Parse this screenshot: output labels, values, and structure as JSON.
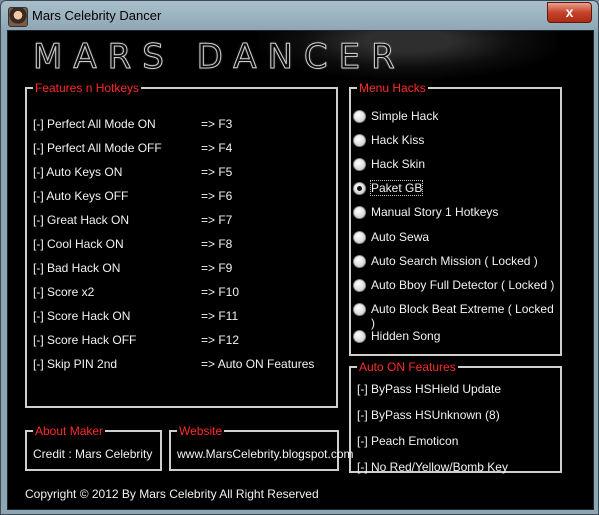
{
  "window": {
    "title": "Mars Celebrity Dancer",
    "close_glyph": "x"
  },
  "logo": "MARS DANCER",
  "features": {
    "legend": "Features n Hotkeys",
    "rows": [
      {
        "label": "[-] Perfect All Mode ON",
        "key": "=> F3"
      },
      {
        "label": "[-] Perfect All Mode OFF",
        "key": "=> F4"
      },
      {
        "label": "[-] Auto Keys ON",
        "key": "=> F5"
      },
      {
        "label": "[-] Auto Keys OFF",
        "key": "=> F6"
      },
      {
        "label": "[-] Great Hack ON",
        "key": "=> F7"
      },
      {
        "label": "[-] Cool Hack ON",
        "key": "=> F8"
      },
      {
        "label": "[-] Bad Hack ON",
        "key": "=> F9"
      },
      {
        "label": "[-] Score x2",
        "key": "=> F10"
      },
      {
        "label": "[-] Score Hack ON",
        "key": "=> F11"
      },
      {
        "label": "[-] Score Hack OFF",
        "key": "=> F12"
      },
      {
        "label": "[-] Skip PIN 2nd",
        "key": "=> Auto ON Features"
      }
    ]
  },
  "menu_hacks": {
    "legend": "Menu Hacks",
    "options": [
      {
        "label": "Simple Hack",
        "checked": false
      },
      {
        "label": "Hack Kiss",
        "checked": false
      },
      {
        "label": "Hack Skin",
        "checked": false
      },
      {
        "label": "Paket GB",
        "checked": true
      },
      {
        "label": "Manual Story 1 Hotkeys",
        "checked": false
      },
      {
        "label": "Auto Sewa",
        "checked": false
      },
      {
        "label": "Auto Search Mission ( Locked )",
        "checked": false
      },
      {
        "label": "Auto Bboy Full Detector ( Locked )",
        "checked": false
      },
      {
        "label": "Auto Block Beat Extreme ( Locked )",
        "checked": false
      },
      {
        "label": "Hidden Song",
        "checked": false
      }
    ]
  },
  "auto_on": {
    "legend": "Auto ON Features",
    "items": [
      "[-] ByPass HSHield Update",
      "[-] ByPass HSUnknown (8)",
      "[-] Peach Emoticon",
      "[-] No Red/Yellow/Bomb Key"
    ]
  },
  "about": {
    "legend": "About Maker",
    "text": "Credit : Mars Celebrity"
  },
  "website": {
    "legend": "Website",
    "text": "www.MarsCelebrity.blogspot.com"
  },
  "copyright": "Copyright © 2012 By Mars Celebrity All Right Reserved"
}
